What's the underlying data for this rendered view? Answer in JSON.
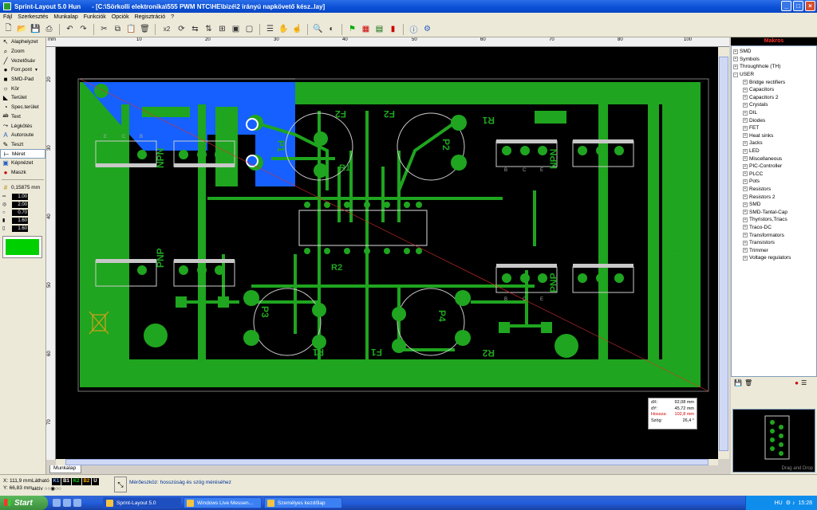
{
  "window": {
    "app": "Sprint-Layout 5.0 Hun",
    "path": "- [C:\\Sörkolli elektronika\\555 PWM NTC\\HE\\bizé\\2 irányú napkövető kész..lay]"
  },
  "menu": [
    "Fájl",
    "Szerkesztés",
    "Munkalap",
    "Funkciók",
    "Opciók",
    "Regisztráció",
    "?"
  ],
  "toolbar_zoom": "x2",
  "tools": [
    {
      "label": "Alaphelyzet",
      "icon": "arrow-icon"
    },
    {
      "label": "Zoom",
      "icon": "magnifier-icon"
    },
    {
      "label": "Vezetősáv",
      "icon": "track-icon"
    },
    {
      "label": "Forr.pont",
      "icon": "pad-icon"
    },
    {
      "label": "SMD-Pad",
      "icon": "smd-pad-icon"
    },
    {
      "label": "Kör",
      "icon": "circle-icon"
    },
    {
      "label": "Terület",
      "icon": "zone-icon"
    },
    {
      "label": "Spec.terület",
      "icon": "special-zone-icon"
    },
    {
      "label": "Text",
      "icon": "text-icon"
    },
    {
      "label": "Légkötés",
      "icon": "airwire-icon"
    },
    {
      "label": "Autoroute",
      "icon": "autoroute-icon"
    },
    {
      "label": "Teszt",
      "icon": "test-icon"
    },
    {
      "label": "Méret",
      "icon": "measure-icon"
    },
    {
      "label": "Képnézet",
      "icon": "photoview-icon"
    },
    {
      "label": "Maszk",
      "icon": "mask-icon"
    }
  ],
  "grid": "0,15875 mm",
  "params": [
    "1.00",
    "2.00",
    "0.70",
    "1.60",
    "1.60"
  ],
  "accent_color": "#00d000",
  "ruler_top": [
    "mm",
    "10",
    "20",
    "30",
    "40",
    "50",
    "60",
    "70",
    "80",
    "90",
    "100",
    "110"
  ],
  "ruler_left": [
    "20",
    "30",
    "40",
    "50",
    "60",
    "70"
  ],
  "sheet_tab": "Munkalap",
  "macros": {
    "header": "Makros",
    "top": [
      "SMD",
      "Symbols",
      "Throughhole (TH)",
      "USER"
    ],
    "user_children": [
      "Bridge rectifiers",
      "Capacitors",
      "Capacitors 2",
      "Crystals",
      "DIL",
      "Diodes",
      "FET",
      "Heat sinks",
      "Jacks",
      "LED",
      "Miscellaneous",
      "PIC-Controller",
      "PLCC",
      "Pots",
      "Resistors",
      "Resistors 2",
      "SMD",
      "SMD-Tantal-Cap",
      "Thyristors,Triacs",
      "Traco-DC",
      "Transformators",
      "Transistors",
      "Trimmer",
      "Voltage regulators"
    ],
    "preview_hint": "Drag and Drop"
  },
  "measure": {
    "dx_label": "dX:",
    "dx": "92,08 mm",
    "dy_label": "dY:",
    "dy": "45,72 mm",
    "len_label": "Hossza:",
    "len": "102,8 mm",
    "ang_label": "Szög:",
    "ang": "26,4 °"
  },
  "status": {
    "x": "X:    111,9 mm",
    "y": "Y:    66,83 mm",
    "visible": "Látható",
    "active": "aktív",
    "layers": [
      "K1",
      "B1",
      "K2",
      "B2",
      "U"
    ],
    "layer_colors": [
      "#6fa8ff",
      "#ffffff",
      "#00e000",
      "#ffb000",
      "#ffffff"
    ],
    "message": "Mérőeszköz: hosszúság és szög méréséhez"
  },
  "taskbar": {
    "start": "Start",
    "tasks": [
      "Sprint-Layout 5.0",
      "Windows Live Messen...",
      "Személyes kezdőlap"
    ],
    "lang": "HU",
    "clock": "15:28"
  },
  "pcb": {
    "labels": [
      "F2",
      "F2",
      "R1",
      "R1",
      "P1",
      "P2",
      "F1",
      "F1",
      "R2",
      "P3",
      "R2",
      "P4",
      "PNP",
      "NPN",
      "INOX",
      "+",
      "-"
    ],
    "pin_labels": [
      "E",
      "C",
      "B"
    ]
  }
}
